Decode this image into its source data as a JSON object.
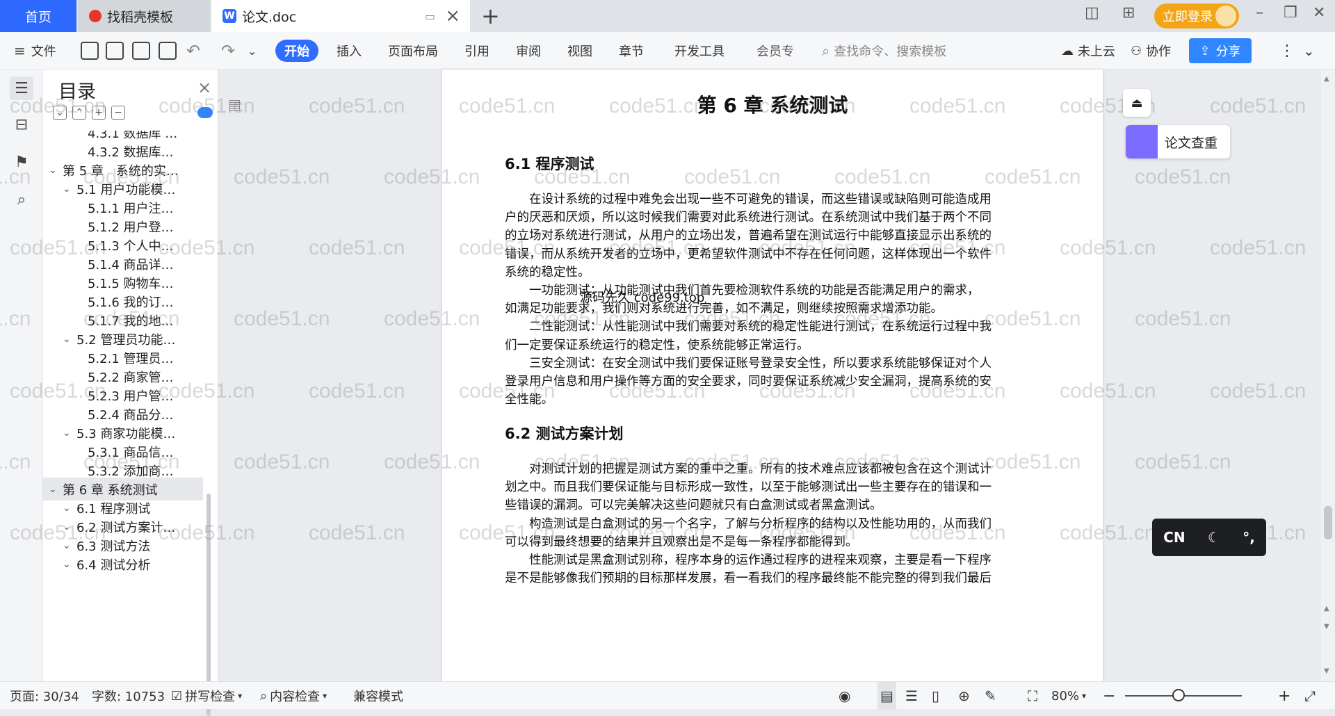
{
  "tabs": {
    "home": "首页",
    "template": "找稻壳模板",
    "doc": "论文.doc"
  },
  "titlebar": {
    "login": "立即登录"
  },
  "toolbar": {
    "file": "文件",
    "menus": [
      "开始",
      "插入",
      "页面布局",
      "引用",
      "审阅",
      "视图",
      "章节",
      "开发工具",
      "会员专"
    ],
    "search_placeholder": "查找命令、搜索模板",
    "cloud": "未上云",
    "collab": "协作",
    "share": "分享"
  },
  "toc": {
    "title": "目录",
    "items": [
      {
        "label": "4.3.1 数据库 …",
        "level": 3
      },
      {
        "label": "4.3.2 数据库…",
        "level": 3
      },
      {
        "label": "第 5 章　系统的实…",
        "level": 1
      },
      {
        "label": "5.1 用户功能模…",
        "level": 2
      },
      {
        "label": "5.1.1 用户注…",
        "level": 3
      },
      {
        "label": "5.1.2 用户登…",
        "level": 3
      },
      {
        "label": "5.1.3 个人中…",
        "level": 3
      },
      {
        "label": "5.1.4 商品详…",
        "level": 3
      },
      {
        "label": "5.1.5 购物车…",
        "level": 3
      },
      {
        "label": "5.1.6 我的订…",
        "level": 3
      },
      {
        "label": "5.1.7 我的地…",
        "level": 3
      },
      {
        "label": "5.2 管理员功能…",
        "level": 2
      },
      {
        "label": "5.2.1 管理员…",
        "level": 3
      },
      {
        "label": "5.2.2 商家管…",
        "level": 3
      },
      {
        "label": "5.2.3 用户管…",
        "level": 3
      },
      {
        "label": "5.2.4 商品分…",
        "level": 3
      },
      {
        "label": "5.3 商家功能模…",
        "level": 2
      },
      {
        "label": "5.3.1 商品信…",
        "level": 3
      },
      {
        "label": "5.3.2 添加商…",
        "level": 3
      },
      {
        "label": "第 6 章  系统测试",
        "level": 1
      },
      {
        "label": "6.1  程序测试",
        "level": 2
      },
      {
        "label": "6.2  测试方案计…",
        "level": 2
      },
      {
        "label": "6.3  测试方法",
        "level": 2
      },
      {
        "label": "6.4  测试分析",
        "level": 2
      }
    ]
  },
  "document": {
    "chapter": "第 6 章  系统测试",
    "h1": "6.1  程序测试",
    "p1": [
      "　　在设计系统的过程中难免会出现一些不可避免的错误，而这些错误或缺陷则可能造成用",
      "户的厌恶和厌烦，所以这时候我们需要对此系统进行测试。在系统测试中我们基于两个不同",
      "的立场对系统进行测试，从用户的立场出发，普遍希望在测试运行中能够直接显示出系统的",
      "错误，而从系统开发者的立场中，更希望软件测试中不存在任何问题，这样体现出一个软件",
      "系统的稳定性。",
      "　　一功能测试：从功能测试中我们首先要检测软件系统的功能是否能满足用户的需求，",
      "如满足功能要求，我们则对系统进行完善，如不满足，则继续按照需求增添功能。",
      "　　二性能测试：从性能测试中我们需要对系统的稳定性能进行测试，在系统运行过程中我",
      "们一定要保证系统运行的稳定性，使系统能够正常运行。",
      "　　三安全测试：在安全测试中我们要保证账号登录安全性，所以要求系统能够保证对个人",
      "登录用户信息和用户操作等方面的安全要求，同时要保证系统减少安全漏洞，提高系统的安",
      "全性能。"
    ],
    "h2": "6.2  测试方案计划",
    "p2": [
      "　　对测试计划的把握是测试方案的重中之重。所有的技术难点应该都被包含在这个测试计",
      "划之中。而且我们要保证能与目标形成一致性，以至于能够测试出一些主要存在的错误和一",
      "些错误的漏洞。可以完美解决这些问题就只有白盒测试或者黑盒测试。",
      "　　构造测试是白盒测试的另一个名字，了解与分析程序的结构以及性能功用的，从而我们",
      "可以得到最终想要的结果并且观察出是不是每一条程序都能得到。",
      "　　性能测试是黑盒测试别称，程序本身的运作通过程序的进程来观察，主要是看一下程序",
      "是不是能够像我们预期的目标那样发展，看一看我们的程序最终能不能完整的得到我们最后"
    ],
    "overlay": "源码先久 code99.top",
    "watermark": "code51.cn"
  },
  "side": {
    "lunwen": "论文查重",
    "cn": "CN"
  },
  "statusbar": {
    "page": "页面: 30/34",
    "words": "字数: 10753",
    "spell": "拼写检查",
    "content": "内容检查",
    "compat": "兼容模式",
    "zoom": "80%"
  }
}
